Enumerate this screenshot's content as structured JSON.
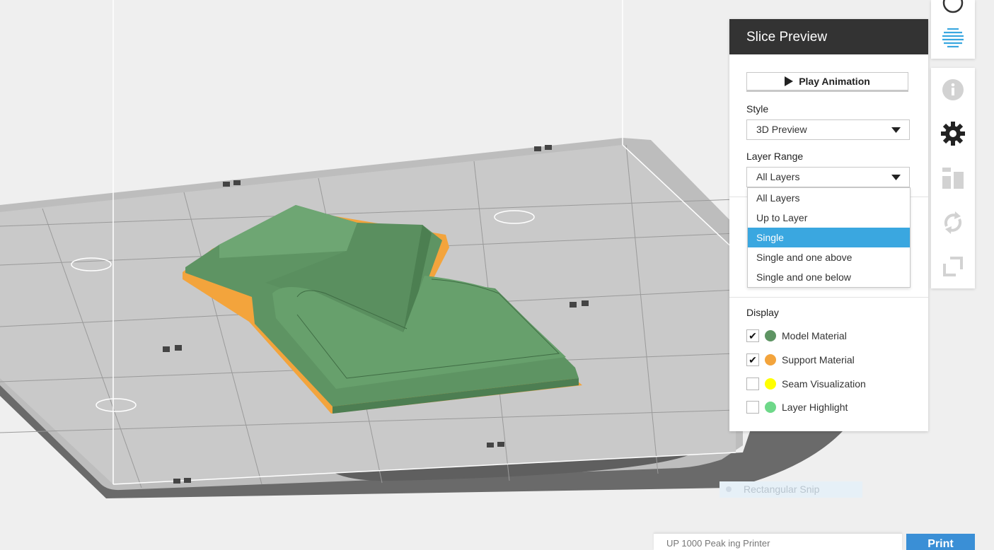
{
  "panel": {
    "title": "Slice Preview",
    "play_label": "Play Animation",
    "style_label": "Style",
    "style_value": "3D Preview",
    "layer_range_label": "Layer Range",
    "layer_range_value": "All Layers",
    "layer_range_options": [
      "All Layers",
      "Up to Layer",
      "Single",
      "Single and one above",
      "Single and one below"
    ],
    "highlighted_option": "Single",
    "display_label": "Display",
    "display_items": [
      {
        "label": "Model Material",
        "checked": true,
        "color": "#5e9463"
      },
      {
        "label": "Support Material",
        "checked": true,
        "color": "#f3a43c"
      },
      {
        "label": "Seam Visualization",
        "checked": false,
        "color": "#ffff00"
      },
      {
        "label": "Layer Highlight",
        "checked": false,
        "color": "#6ed889"
      }
    ]
  },
  "toolbar": {
    "icons": [
      "layers-icon",
      "info-icon",
      "gear-icon",
      "arrange-icon",
      "rotate-icon",
      "scale-icon"
    ]
  },
  "overlay": {
    "snip_label": "Rectangular Snip"
  },
  "bottom": {
    "field_text": "UP 1000   Peak   ing Printer",
    "button_text": "Print"
  },
  "colors": {
    "accent": "#3aa7e0",
    "header_bg": "#333333",
    "model": "#5e9463",
    "support": "#f3a43c",
    "bed": "#c9c9c9"
  }
}
